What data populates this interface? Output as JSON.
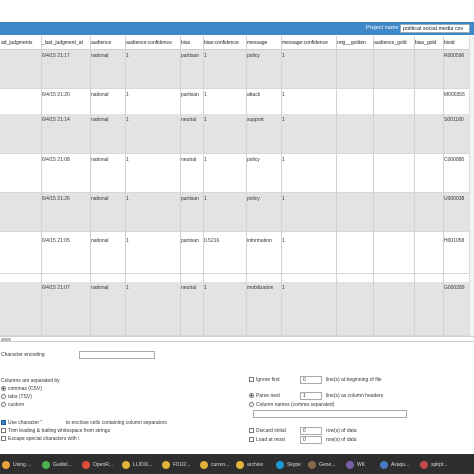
{
  "project": {
    "label": "Project name",
    "value": "political social media csv"
  },
  "columns": [
    "ad_judgments",
    "_last_judgment_at",
    "audience",
    "audience:confidence",
    "bias",
    "bias:confidence",
    "message",
    "message:confidence",
    "orig__golden",
    "audience_gold",
    "bias_gold",
    "bioid"
  ],
  "rows": [
    {
      "last": "6/4/15 21:17",
      "audience": "national",
      "aconf": "1",
      "bias": "partisan",
      "bconf": "1",
      "message": "policy",
      "mconf": "1",
      "bioid": "R000596"
    },
    {
      "last": "6/4/15 21:20",
      "audience": "national",
      "aconf": "1",
      "bias": "partisan",
      "bconf": "1",
      "message": "attack",
      "mconf": "1",
      "bioid": "M000355"
    },
    {
      "last": "6/4/15 21:14",
      "audience": "national",
      "aconf": "1",
      "bias": "neutral",
      "bconf": "1",
      "message": "support",
      "mconf": "1",
      "bioid": "S001180"
    },
    {
      "last": "6/4/15 21:08",
      "audience": "national",
      "aconf": "1",
      "bias": "neutral",
      "bconf": "1",
      "message": "policy",
      "mconf": "1",
      "bioid": "C000880"
    },
    {
      "last": "6/4/15 21:26",
      "audience": "national",
      "aconf": "1",
      "bias": "partisan",
      "bconf": "1",
      "message": "policy",
      "mconf": "1",
      "bioid": "U000038"
    },
    {
      "last": "6/4/15 21:05",
      "audience": "national",
      "aconf": "1",
      "bias": "partisan",
      "bconf": "0.5216",
      "message": "information",
      "mconf": "1",
      "bioid": "H001058"
    },
    {
      "last": "6/4/15 21:07",
      "audience": "national",
      "aconf": "1",
      "bias": "neutral",
      "bconf": "1",
      "message": "mobilization",
      "mconf": "1",
      "bioid": "G000289"
    }
  ],
  "options": {
    "char_encoding": "Character encoding",
    "columns_sep": "Columns are separated by",
    "sep_commas": "commas (CSV)",
    "sep_tabs": "tabs (TSV)",
    "sep_custom": "custom",
    "use_char": "Use character \"",
    "use_char_rest": "to enclose cells containing column separators",
    "trim": "Trim leading & trailing whitespace from strings",
    "escape": "Escape special characters with \\",
    "ignore_first": "Ignore first",
    "ignore_first_val": "0",
    "ignore_first_rest": "line(s) at beginning of file",
    "parse_next": "Parse next",
    "parse_next_val": "1",
    "parse_next_rest": "line(s) as column headers",
    "colnames": "Column names (comma separated)",
    "discard": "Discard initial",
    "discard_val": "0",
    "discard_rest": "row(s) of data",
    "load_at_most": "Load at most",
    "load_val": "0",
    "load_rest": "row(s) of data"
  },
  "taskbar": [
    {
      "icon": "chrome-icon",
      "label": "Using ...",
      "color": "#e8a23a"
    },
    {
      "icon": "chrome-icon",
      "label": "Guidel...",
      "color": "#4caf50"
    },
    {
      "icon": "chrome-icon",
      "label": "OpenR...",
      "color": "#e04b3a"
    },
    {
      "icon": "folder-icon",
      "label": "LLIDIX...",
      "color": "#e0b23a"
    },
    {
      "icon": "folder-icon",
      "label": "FDU2...",
      "color": "#e0b23a"
    },
    {
      "icon": "folder-icon",
      "label": "curren...",
      "color": "#e0b23a"
    },
    {
      "icon": "folder-icon",
      "label": "archive",
      "color": "#e0b23a"
    },
    {
      "icon": "skype-icon",
      "label": "Skype",
      "color": "#1e9bd7"
    },
    {
      "icon": "gimp-icon",
      "label": "Gene...",
      "color": "#8a6a4a"
    },
    {
      "icon": "app-icon",
      "label": "WK",
      "color": "#7b5ea7"
    },
    {
      "icon": "app-icon",
      "label": "Avaqu...",
      "color": "#4a78c2"
    },
    {
      "icon": "app-icon",
      "label": "splrpt...",
      "color": "#c24a4a"
    }
  ]
}
